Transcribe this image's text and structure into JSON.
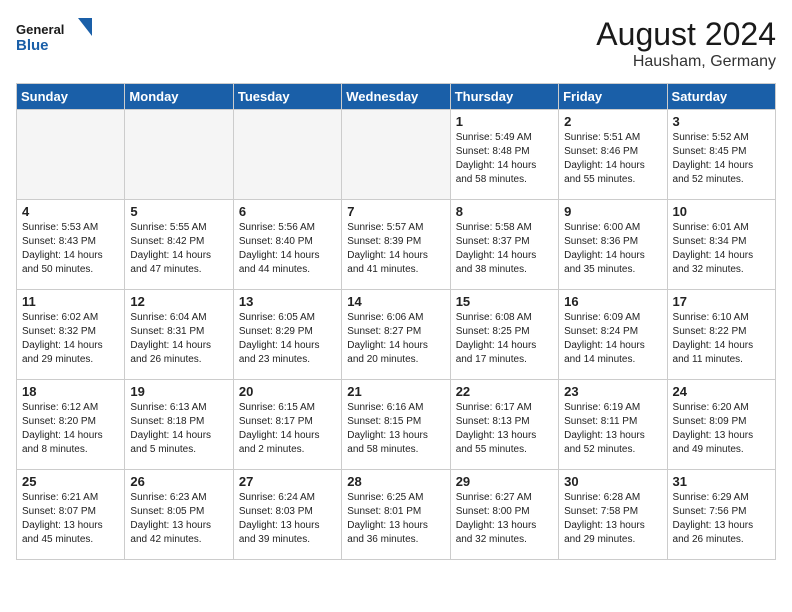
{
  "header": {
    "logo_line1": "General",
    "logo_line2": "Blue",
    "month_year": "August 2024",
    "location": "Hausham, Germany"
  },
  "weekdays": [
    "Sunday",
    "Monday",
    "Tuesday",
    "Wednesday",
    "Thursday",
    "Friday",
    "Saturday"
  ],
  "weeks": [
    [
      {
        "day": "",
        "text": ""
      },
      {
        "day": "",
        "text": ""
      },
      {
        "day": "",
        "text": ""
      },
      {
        "day": "",
        "text": ""
      },
      {
        "day": "1",
        "text": "Sunrise: 5:49 AM\nSunset: 8:48 PM\nDaylight: 14 hours\nand 58 minutes."
      },
      {
        "day": "2",
        "text": "Sunrise: 5:51 AM\nSunset: 8:46 PM\nDaylight: 14 hours\nand 55 minutes."
      },
      {
        "day": "3",
        "text": "Sunrise: 5:52 AM\nSunset: 8:45 PM\nDaylight: 14 hours\nand 52 minutes."
      }
    ],
    [
      {
        "day": "4",
        "text": "Sunrise: 5:53 AM\nSunset: 8:43 PM\nDaylight: 14 hours\nand 50 minutes."
      },
      {
        "day": "5",
        "text": "Sunrise: 5:55 AM\nSunset: 8:42 PM\nDaylight: 14 hours\nand 47 minutes."
      },
      {
        "day": "6",
        "text": "Sunrise: 5:56 AM\nSunset: 8:40 PM\nDaylight: 14 hours\nand 44 minutes."
      },
      {
        "day": "7",
        "text": "Sunrise: 5:57 AM\nSunset: 8:39 PM\nDaylight: 14 hours\nand 41 minutes."
      },
      {
        "day": "8",
        "text": "Sunrise: 5:58 AM\nSunset: 8:37 PM\nDaylight: 14 hours\nand 38 minutes."
      },
      {
        "day": "9",
        "text": "Sunrise: 6:00 AM\nSunset: 8:36 PM\nDaylight: 14 hours\nand 35 minutes."
      },
      {
        "day": "10",
        "text": "Sunrise: 6:01 AM\nSunset: 8:34 PM\nDaylight: 14 hours\nand 32 minutes."
      }
    ],
    [
      {
        "day": "11",
        "text": "Sunrise: 6:02 AM\nSunset: 8:32 PM\nDaylight: 14 hours\nand 29 minutes."
      },
      {
        "day": "12",
        "text": "Sunrise: 6:04 AM\nSunset: 8:31 PM\nDaylight: 14 hours\nand 26 minutes."
      },
      {
        "day": "13",
        "text": "Sunrise: 6:05 AM\nSunset: 8:29 PM\nDaylight: 14 hours\nand 23 minutes."
      },
      {
        "day": "14",
        "text": "Sunrise: 6:06 AM\nSunset: 8:27 PM\nDaylight: 14 hours\nand 20 minutes."
      },
      {
        "day": "15",
        "text": "Sunrise: 6:08 AM\nSunset: 8:25 PM\nDaylight: 14 hours\nand 17 minutes."
      },
      {
        "day": "16",
        "text": "Sunrise: 6:09 AM\nSunset: 8:24 PM\nDaylight: 14 hours\nand 14 minutes."
      },
      {
        "day": "17",
        "text": "Sunrise: 6:10 AM\nSunset: 8:22 PM\nDaylight: 14 hours\nand 11 minutes."
      }
    ],
    [
      {
        "day": "18",
        "text": "Sunrise: 6:12 AM\nSunset: 8:20 PM\nDaylight: 14 hours\nand 8 minutes."
      },
      {
        "day": "19",
        "text": "Sunrise: 6:13 AM\nSunset: 8:18 PM\nDaylight: 14 hours\nand 5 minutes."
      },
      {
        "day": "20",
        "text": "Sunrise: 6:15 AM\nSunset: 8:17 PM\nDaylight: 14 hours\nand 2 minutes."
      },
      {
        "day": "21",
        "text": "Sunrise: 6:16 AM\nSunset: 8:15 PM\nDaylight: 13 hours\nand 58 minutes."
      },
      {
        "day": "22",
        "text": "Sunrise: 6:17 AM\nSunset: 8:13 PM\nDaylight: 13 hours\nand 55 minutes."
      },
      {
        "day": "23",
        "text": "Sunrise: 6:19 AM\nSunset: 8:11 PM\nDaylight: 13 hours\nand 52 minutes."
      },
      {
        "day": "24",
        "text": "Sunrise: 6:20 AM\nSunset: 8:09 PM\nDaylight: 13 hours\nand 49 minutes."
      }
    ],
    [
      {
        "day": "25",
        "text": "Sunrise: 6:21 AM\nSunset: 8:07 PM\nDaylight: 13 hours\nand 45 minutes."
      },
      {
        "day": "26",
        "text": "Sunrise: 6:23 AM\nSunset: 8:05 PM\nDaylight: 13 hours\nand 42 minutes."
      },
      {
        "day": "27",
        "text": "Sunrise: 6:24 AM\nSunset: 8:03 PM\nDaylight: 13 hours\nand 39 minutes."
      },
      {
        "day": "28",
        "text": "Sunrise: 6:25 AM\nSunset: 8:01 PM\nDaylight: 13 hours\nand 36 minutes."
      },
      {
        "day": "29",
        "text": "Sunrise: 6:27 AM\nSunset: 8:00 PM\nDaylight: 13 hours\nand 32 minutes."
      },
      {
        "day": "30",
        "text": "Sunrise: 6:28 AM\nSunset: 7:58 PM\nDaylight: 13 hours\nand 29 minutes."
      },
      {
        "day": "31",
        "text": "Sunrise: 6:29 AM\nSunset: 7:56 PM\nDaylight: 13 hours\nand 26 minutes."
      }
    ]
  ]
}
